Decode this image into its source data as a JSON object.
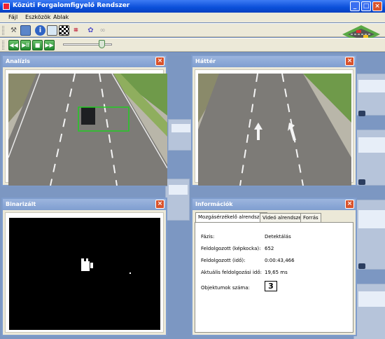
{
  "window": {
    "title": "Közúti Forgalomfigyelő Rendszer"
  },
  "menu": {
    "items": [
      "Fájl",
      "Eszközök",
      "Ablak"
    ]
  },
  "toolbar1": {
    "icons": [
      "wrench-icon",
      "monitor-icon",
      "info-icon",
      "image-icon",
      "checker-icon",
      "transform-icon",
      "gear-icon",
      "link-icon"
    ]
  },
  "toolbar2": {
    "buttons": [
      "◀◀",
      "▶ll",
      "■",
      "▶▶"
    ]
  },
  "playback": {
    "position": 0.74
  },
  "panels": {
    "analysis": {
      "title": "Analízis"
    },
    "background": {
      "title": "Háttér"
    },
    "binarized": {
      "title": "Binarizált"
    },
    "info": {
      "title": "Információk"
    }
  },
  "info": {
    "tabs": [
      "Mozgásérzékelő alrendszer",
      "Videó alrendszer",
      "Forrás"
    ],
    "rows": [
      {
        "label": "Fázis:",
        "value": "Detektálás"
      },
      {
        "label": "Feldolgozott (képkocka):",
        "value": "652"
      },
      {
        "label": "Feldolgozott (idő):",
        "value": "0:00:43,466"
      },
      {
        "label": "Aktuális feldolgozási idő:",
        "value": "19,65 ms"
      }
    ],
    "objects_label": "Objektumok száma:",
    "objects_count": "3"
  },
  "colors": {
    "titlebar": "#0a4fd9",
    "panel_border": "#7e9ccc",
    "close": "#d9532c",
    "detection_box": "#22cc22"
  }
}
